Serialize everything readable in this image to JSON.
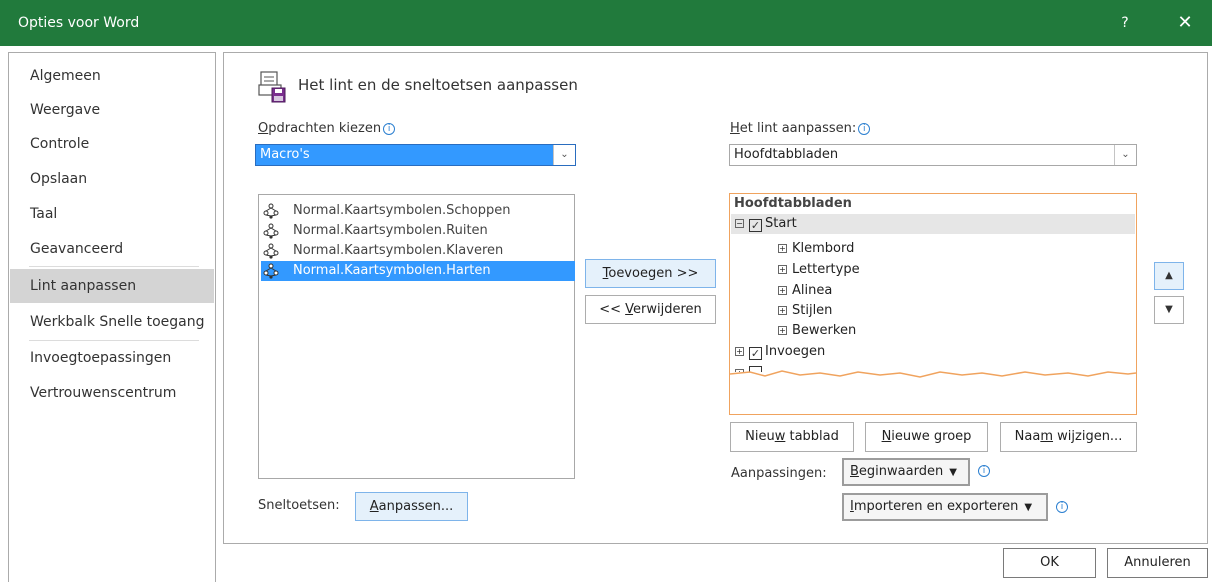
{
  "window": {
    "title": "Opties voor Word",
    "help_glyph": "?",
    "close_glyph": "✕"
  },
  "sidebar": {
    "items": [
      {
        "label": "Algemeen"
      },
      {
        "label": "Weergave"
      },
      {
        "label": "Controle"
      },
      {
        "label": "Opslaan"
      },
      {
        "label": "Taal"
      },
      {
        "label": "Geavanceerd"
      },
      {
        "label": "Lint aanpassen",
        "selected": true
      },
      {
        "label": "Werkbalk Snelle toegang"
      },
      {
        "label": "Invoegtoepassingen"
      },
      {
        "label": "Vertrouwenscentrum"
      }
    ]
  },
  "section": {
    "title": "Het lint en de sneltoetsen aanpassen"
  },
  "commands": {
    "label_first": "O",
    "label_rest": "pdrachten kiezen",
    "info": "i",
    "selected_value": "Macro's",
    "items": [
      {
        "label": "Normal.Kaartsymbolen.Schoppen"
      },
      {
        "label": "Normal.Kaartsymbolen.Ruiten"
      },
      {
        "label": "Normal.Kaartsymbolen.Klaveren"
      },
      {
        "label": "Normal.Kaartsymbolen.Harten",
        "selected": true
      }
    ]
  },
  "middle_buttons": {
    "add_first": "T",
    "add_rest": "oevoegen >>",
    "remove_pre": "<< ",
    "remove_u": "V",
    "remove_rest": "erwijderen"
  },
  "ribbon": {
    "label_first": "H",
    "label_rest": "et lint aanpassen:",
    "info": "i",
    "selected_value": "Hoofdtabbladen",
    "tree_header": "Hoofdtabbladen",
    "start_tab": "Start",
    "groups": [
      "Klembord",
      "Lettertype",
      "Alinea",
      "Stijlen",
      "Bewerken"
    ],
    "insert_tab": "Invoegen",
    "check_glyph": "✓"
  },
  "tree_buttons": {
    "new_tab_pre": "Nieu",
    "new_tab_u": "w",
    "new_tab_rest": " tabblad",
    "new_group_u": "N",
    "new_group_rest": "ieuwe groep",
    "rename_pre": "Naa",
    "rename_u": "m",
    "rename_rest": " wijzigen..."
  },
  "customizations": {
    "label": "Aanpassingen:",
    "reset_u": "B",
    "reset_rest": "eginwaarden",
    "import_u": "I",
    "import_rest": "mporteren en exporteren",
    "dropdown_glyph": "▼",
    "info": "i"
  },
  "shortcuts": {
    "label": "Sneltoetsen:",
    "button_u": "A",
    "button_rest": "anpassen..."
  },
  "footer": {
    "ok": "OK",
    "cancel": "Annuleren"
  },
  "move_up_glyph": "▲",
  "move_down_glyph": "▼",
  "colors": {
    "titlebar": "#217a3c",
    "selection": "#3399ff",
    "tree_border": "#f0a35e"
  }
}
